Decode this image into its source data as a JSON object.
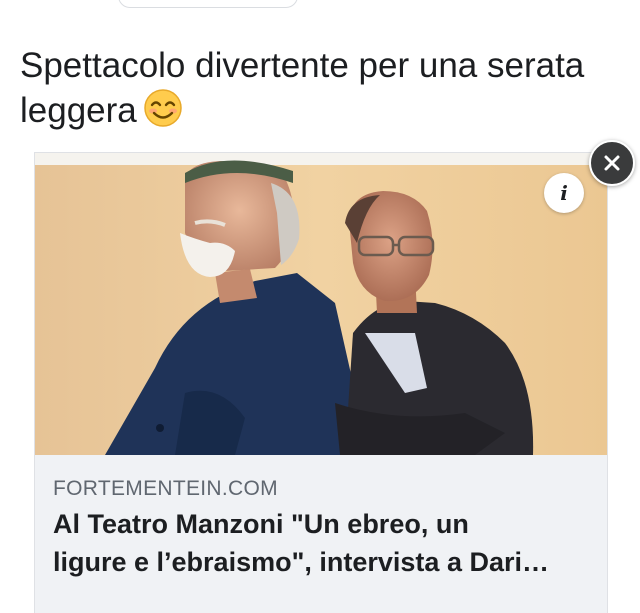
{
  "post": {
    "text": "Spettacolo divertente per una serata leggera",
    "emoji_icon": "smiling-face-icon"
  },
  "link_card": {
    "domain": "FORTEMENTEIN.COM",
    "title": "Al Teatro Manzoni \"Un ebreo, un\nligure e l’ebraismo\", intervista a Dari…",
    "info_glyph": "i",
    "info_icon": "info-icon",
    "close_icon": "close-icon",
    "image_icon": "photo-two-men-back-to-back"
  },
  "colors": {
    "background": "#ffffff",
    "card_meta_background": "#f0f2f5",
    "title_text": "#1c1e21",
    "domain_text": "#606770",
    "close_button": "#3a3b3c",
    "photo_wall": "#efcf9e"
  }
}
